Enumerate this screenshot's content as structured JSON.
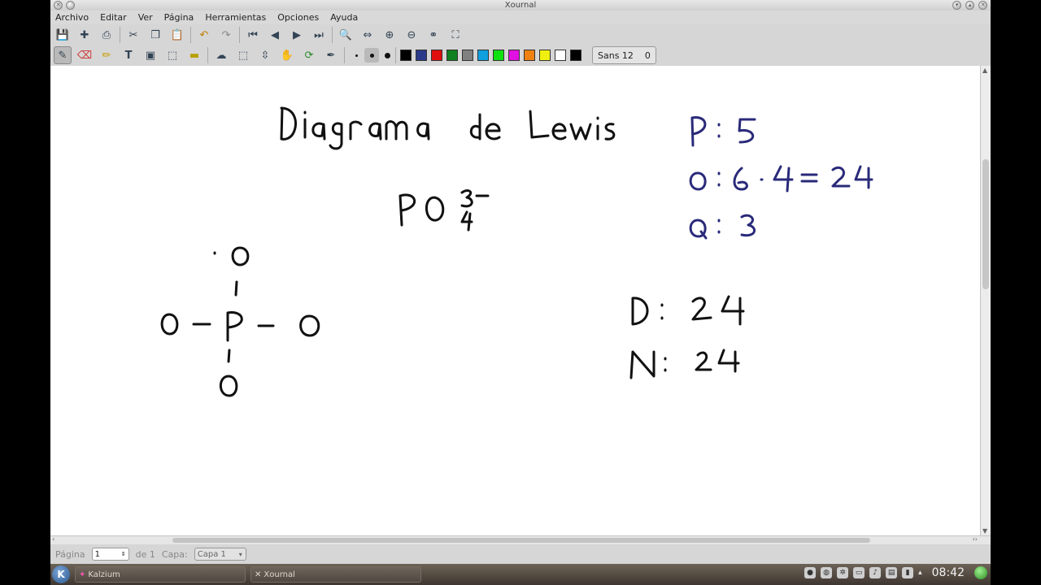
{
  "window": {
    "title": "Xournal"
  },
  "menu": [
    "Archivo",
    "Editar",
    "Ver",
    "Página",
    "Herramientas",
    "Opciones",
    "Ayuda"
  ],
  "toolbar1_icons": [
    "save-icon",
    "new-page-icon",
    "print-icon",
    "cut-icon",
    "copy-icon",
    "paste-icon",
    "undo-icon",
    "redo-icon",
    "first-page-icon",
    "previous-page-icon",
    "next-page-icon",
    "last-page-icon",
    "zoom-icon",
    "page-width-icon",
    "zoom-in-icon",
    "zoom-out-icon",
    "binoculars-icon",
    "fullscreen-icon"
  ],
  "toolbar2_icons": [
    "pen-icon",
    "eraser-icon",
    "highlighter-icon",
    "text-icon",
    "image-icon",
    "select-region-icon",
    "ruler-icon",
    "select-rectangle-icon",
    "vertical-space-icon",
    "lasso-icon",
    "hand-icon",
    "refresh-icon",
    "default-pen-icon"
  ],
  "colors": [
    "#000000",
    "#2a3a8a",
    "#e01010",
    "#108020",
    "#808080",
    "#10a0e0",
    "#10e010",
    "#e010e0",
    "#f08010",
    "#f0f010",
    "#ffffff",
    "#000000"
  ],
  "font_button": {
    "name": "Sans 12",
    "size": "0"
  },
  "page_content": {
    "title": "Diagrama de Lewis",
    "formula": "PO",
    "formula_charge": "3−",
    "formula_sub": "4",
    "counts": [
      "P: 5",
      "O: 6 · 4 = 24",
      "Q: 3"
    ],
    "totals": [
      "D: 24",
      "N: 24"
    ],
    "structure": {
      "center": "P",
      "ligands": [
        "O",
        "O",
        "O",
        "O"
      ]
    }
  },
  "ink_color": "#2a2a7a",
  "status": {
    "page_label": "Página",
    "page_value": "1",
    "of_label": "de 1",
    "layer_label": "Capa:",
    "layer_value": "Capa 1"
  },
  "taskbar": {
    "tasks": [
      "Kalzium",
      "Xournal"
    ],
    "clock": "08:42"
  }
}
